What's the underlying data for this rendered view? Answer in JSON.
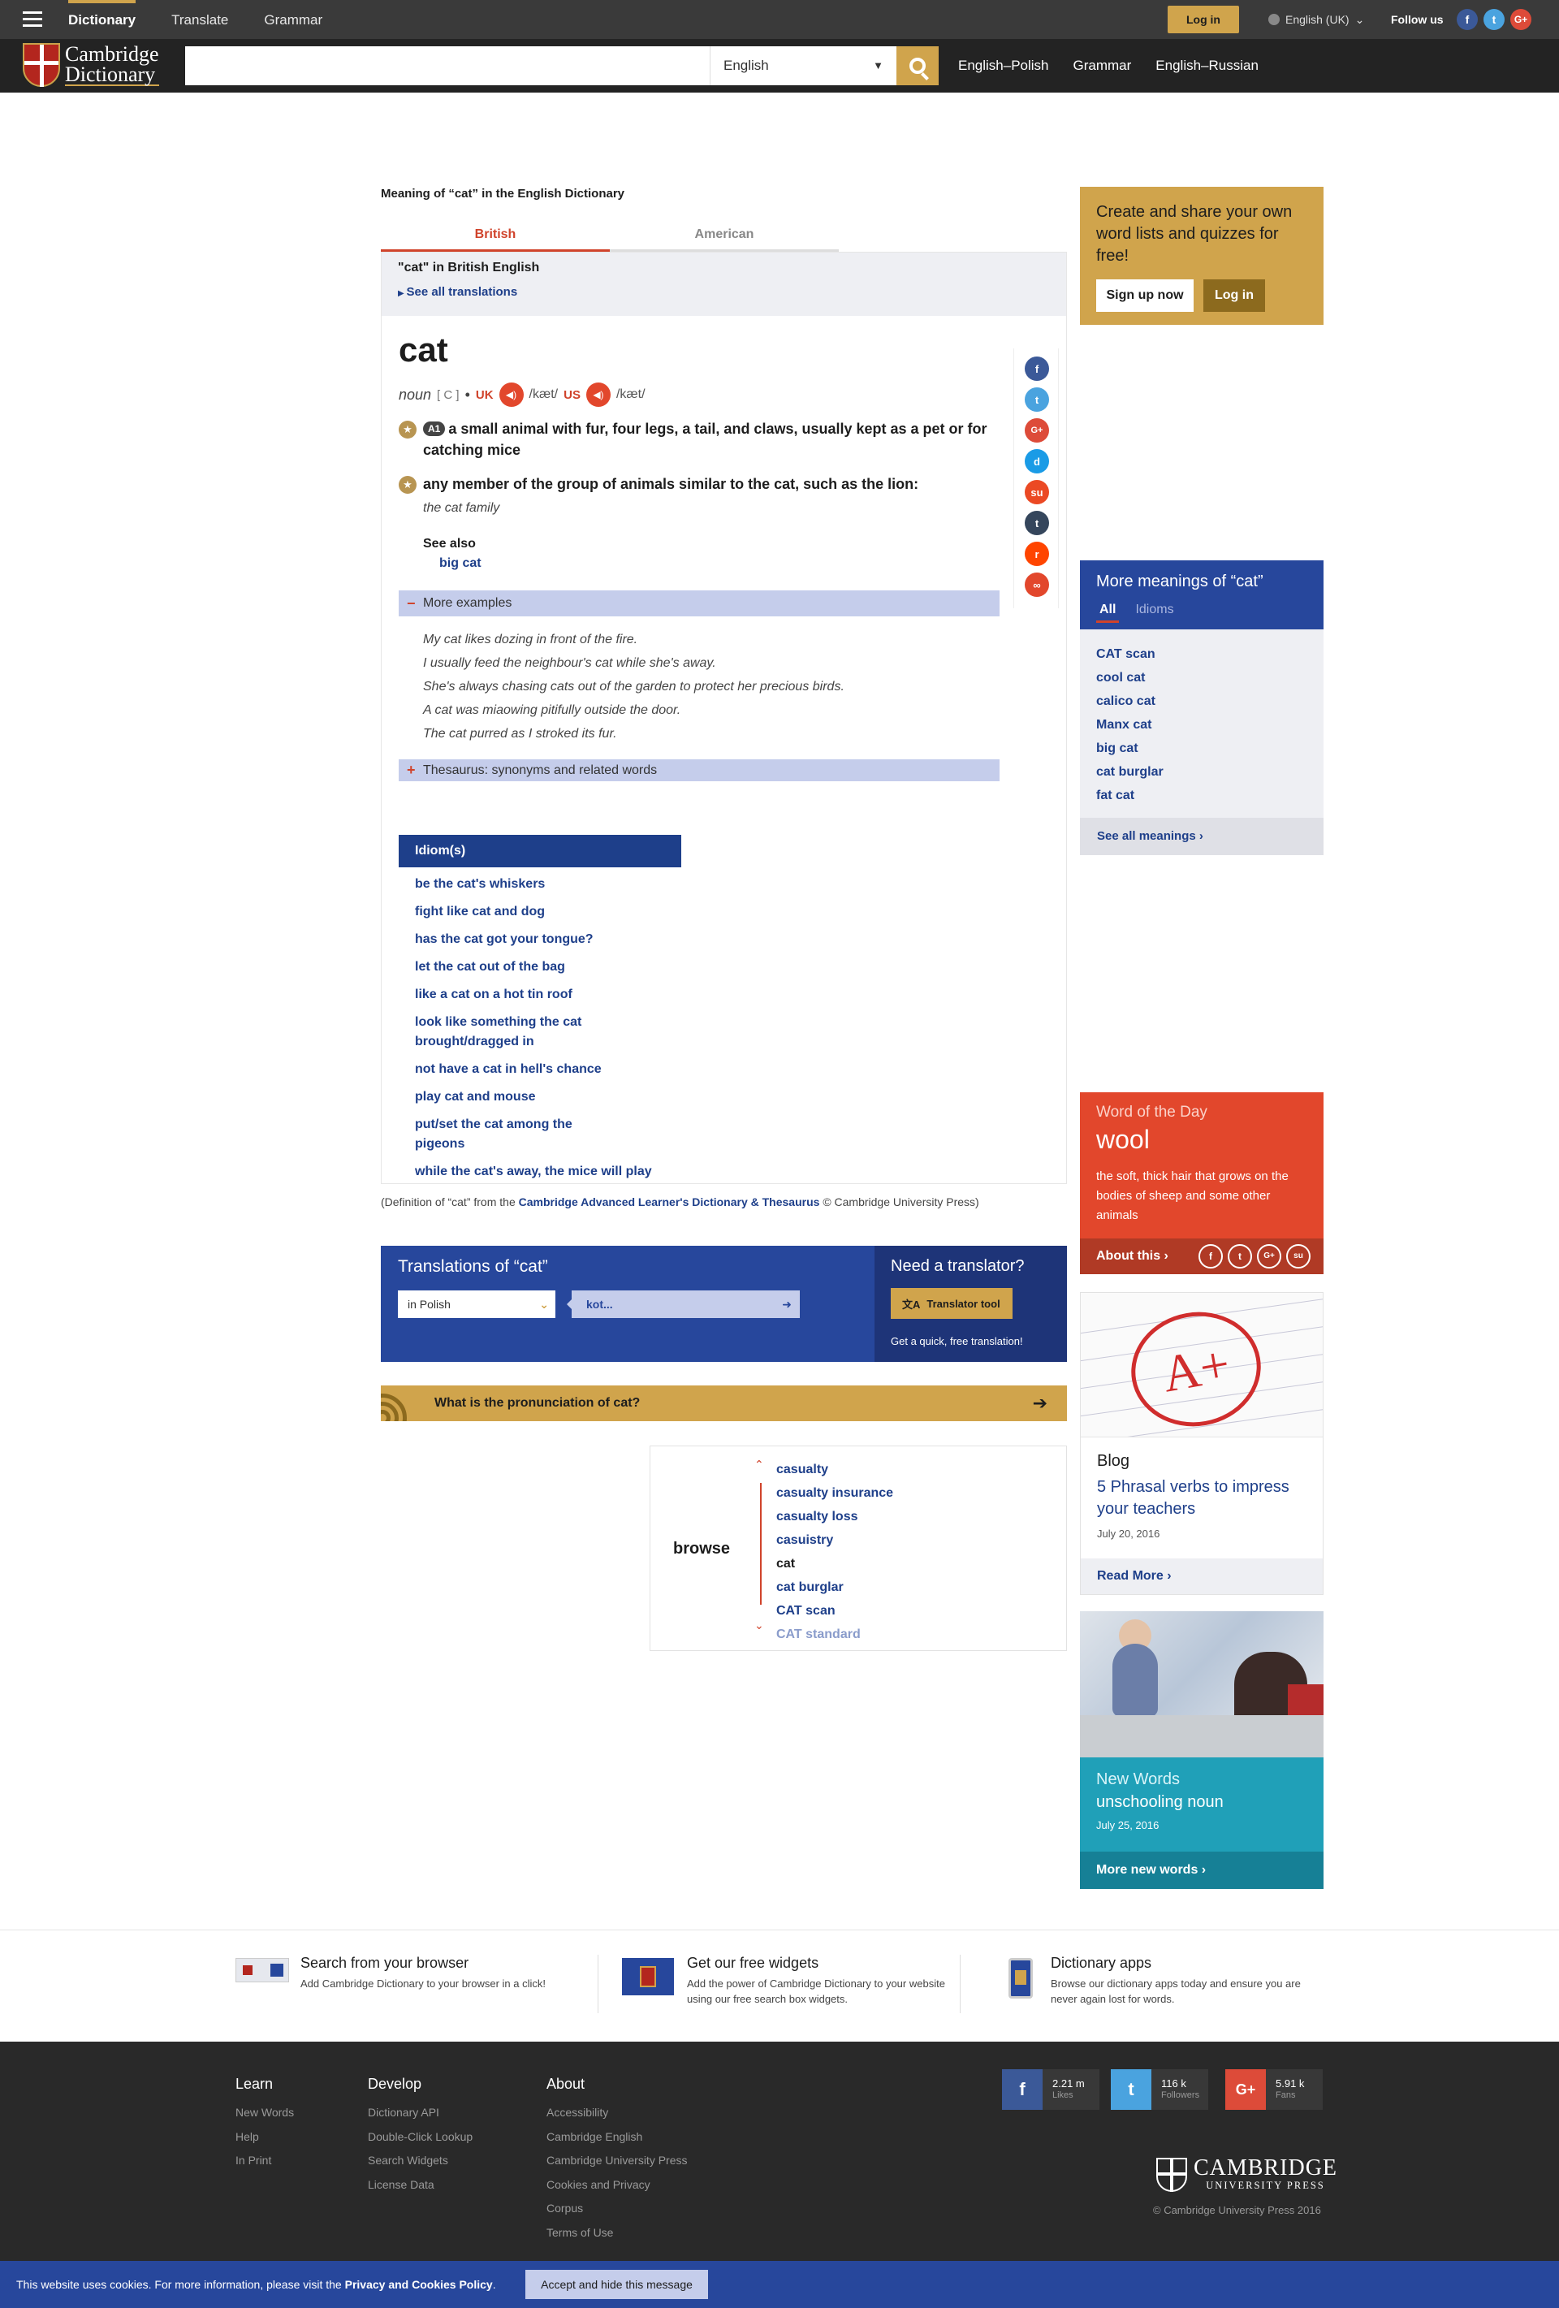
{
  "topbar": {
    "nav": [
      "Dictionary",
      "Translate",
      "Grammar"
    ],
    "login": "Log in",
    "ui_language": "English (UK)",
    "follow_us": "Follow us"
  },
  "header": {
    "logo_line1": "Cambridge",
    "logo_line2": "Dictionary",
    "search_placeholder": "",
    "search_dictionary": "English",
    "links": [
      "English–Polish",
      "Grammar",
      "English–Russian"
    ]
  },
  "entry": {
    "page_heading": "Meaning of “cat” in the English Dictionary",
    "tabs": [
      "British",
      "American"
    ],
    "section_label": "\"cat\" in British English",
    "see_translations": "See all translations",
    "headword": "cat",
    "pos": "noun",
    "grammar": "[ C ]",
    "uk_label": "UK",
    "uk_ipa": "/kæt/",
    "us_label": "US",
    "us_ipa": "/kæt/",
    "sense1_level": "A1",
    "sense1_def": "a small animal with fur, four legs, a tail, and claws, usually kept as a pet or for catching mice",
    "sense2_def": "any member of the group of animals similar to the cat, such as the lion:",
    "sense2_example": "the cat family",
    "see_also_label": "See also",
    "see_also_link": "big cat",
    "more_examples_label": "More examples",
    "more_examples": [
      "My cat likes dozing in front of the fire.",
      "I usually feed the neighbour's cat while she's away.",
      "She's always chasing cats out of the garden to protect her precious birds.",
      "A cat was miaowing pitifully outside the door.",
      "The cat purred as I stroked its fur."
    ],
    "thesaurus_label": "Thesaurus: synonyms and related words",
    "idioms_label": "Idiom(s)",
    "idioms": [
      "be the cat's whiskers",
      "fight like cat and dog",
      "has the cat got your tongue?",
      "let the cat out of the bag",
      "like a cat on a hot tin roof",
      "look like something the cat brought/dragged in",
      "not have a cat in hell's chance",
      "play cat and mouse",
      "put/set the cat among the pigeons",
      "while the cat's away, the mice will play"
    ],
    "source_prefix": "(Definition of “cat” from the ",
    "source_link": "Cambridge Advanced Learner's Dictionary & Thesaurus",
    "source_suffix": " © Cambridge University Press)"
  },
  "translations": {
    "title": "Translations of “cat”",
    "language": "in Polish",
    "result": "kot...",
    "need_title": "Need a translator?",
    "tool_button": "Translator tool",
    "tool_sub": "Get a quick, free translation!"
  },
  "pronunciation_bar": "What is the pronunciation of cat?",
  "browse": {
    "label": "browse",
    "items": [
      "casualty",
      "casualty insurance",
      "casualty loss",
      "casuistry",
      "cat",
      "cat burglar",
      "CAT scan",
      "CAT standard"
    ]
  },
  "sidebar": {
    "cta_text": "Create and share your own word lists and quizzes for free!",
    "cta_signup": "Sign up now",
    "cta_login": "Log in",
    "more_title": "More meanings of “cat”",
    "more_tabs": [
      "All",
      "Idioms"
    ],
    "more_items": [
      "CAT scan",
      "cool cat",
      "calico cat",
      "Manx cat",
      "big cat",
      "cat burglar",
      "fat cat"
    ],
    "more_all": "See all meanings ›",
    "wotd_label": "Word of the Day",
    "wotd_word": "wool",
    "wotd_def": "the soft, thick hair that grows on the bodies of sheep and some other animals",
    "wotd_about": "About this ›",
    "blog_label": "Blog",
    "blog_title": "5 Phrasal verbs to impress your teachers",
    "blog_date": "July 20, 2016",
    "blog_more": "Read More ›",
    "blog_image_text": "A+",
    "nw_label": "New Words",
    "nw_word": "unschooling noun",
    "nw_date": "July 25, 2016",
    "nw_more": "More new words ›"
  },
  "promo": [
    {
      "title": "Search from your browser",
      "text": "Add Cambridge Dictionary to your browser in a click!"
    },
    {
      "title": "Get our free widgets",
      "text": "Add the power of Cambridge Dictionary to your website using our free search box widgets."
    },
    {
      "title": "Dictionary apps",
      "text": "Browse our dictionary apps today and ensure you are never again lost for words."
    }
  ],
  "footer": {
    "learn_title": "Learn",
    "learn": [
      "New Words",
      "Help",
      "In Print"
    ],
    "develop_title": "Develop",
    "develop": [
      "Dictionary API",
      "Double-Click Lookup",
      "Search Widgets",
      "License Data"
    ],
    "about_title": "About",
    "about": [
      "Accessibility",
      "Cambridge English",
      "Cambridge University Press",
      "Cookies and Privacy",
      "Corpus",
      "Terms of Use"
    ],
    "social": [
      {
        "count": "2.21 m",
        "unit": "Likes"
      },
      {
        "count": "116 k",
        "unit": "Followers"
      },
      {
        "count": "5.91 k",
        "unit": "Fans"
      }
    ],
    "cup_line1": "CAMBRIDGE",
    "cup_line2": "UNIVERSITY PRESS",
    "copyright": "© Cambridge University Press 2016"
  },
  "cookie": {
    "message_prefix": "This website uses cookies. For more information, please visit the ",
    "message_link": "Privacy and Cookies Policy",
    "message_suffix": ".",
    "button": "Accept and hide this message"
  },
  "colors": {
    "brand_gold": "#d0a44c",
    "brand_blue": "#27479c",
    "accent_red": "#d0432b",
    "dark": "#232323"
  }
}
